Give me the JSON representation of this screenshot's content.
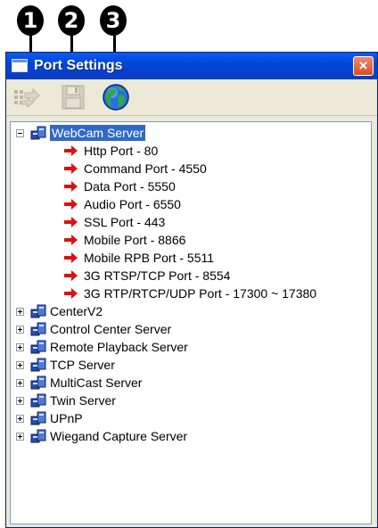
{
  "callouts": [
    "1",
    "2",
    "3"
  ],
  "window": {
    "title": "Port Settings",
    "close_glyph": "×"
  },
  "toolbar": {
    "tools": [
      {
        "icon": "connect-arrows-icon",
        "enabled": false
      },
      {
        "icon": "floppy-save-icon",
        "enabled": false
      },
      {
        "icon": "globe-icon",
        "enabled": true
      }
    ]
  },
  "tree": {
    "root": {
      "label": "WebCam Server",
      "expanded": true,
      "selected": true,
      "ports": [
        "Http Port - 80",
        "Command Port - 4550",
        "Data Port - 5550",
        "Audio Port - 6550",
        "SSL Port - 443",
        "Mobile Port - 8866",
        "Mobile RPB Port - 5511",
        "3G RTSP/TCP Port - 8554",
        "3G RTP/RTCP/UDP Port - 17300 ~ 17380"
      ]
    },
    "servers": [
      "CenterV2",
      "Control Center Server",
      "Remote Playback Server",
      "TCP Server",
      "MultiCast Server",
      "Twin Server",
      "UPnP",
      "Wiegand Capture Server"
    ]
  },
  "colors": {
    "title_bar": "#0047d8",
    "selection": "#316ac5",
    "port_arrow": "#e01010",
    "close_button": "#d64d22"
  }
}
